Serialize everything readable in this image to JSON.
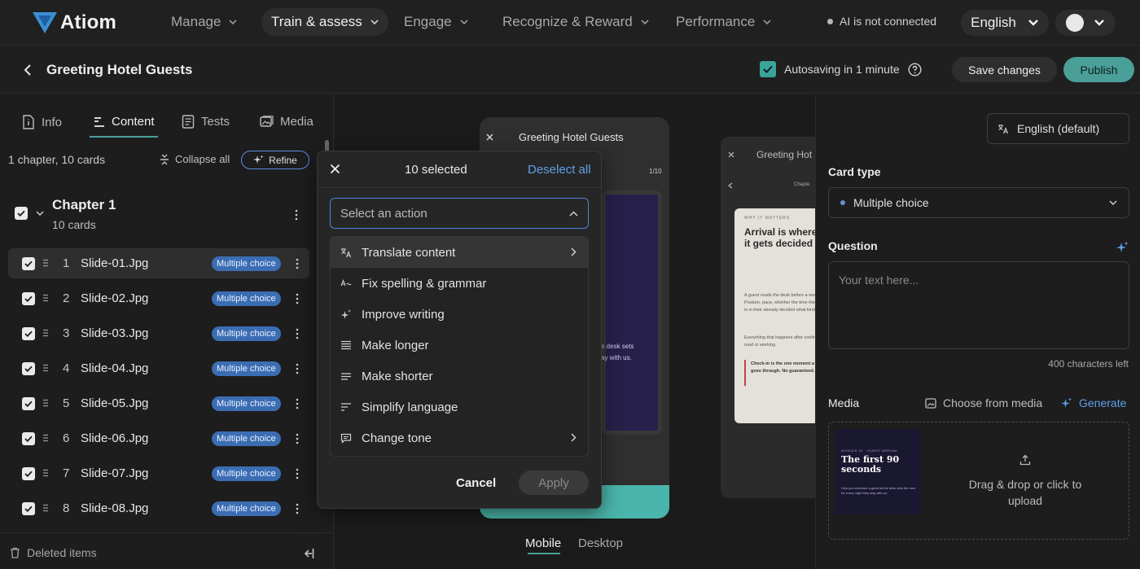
{
  "app": {
    "logo_text": "Atiom"
  },
  "nav": {
    "items": [
      {
        "label": "Manage"
      },
      {
        "label": "Train & assess"
      },
      {
        "label": "Engage"
      },
      {
        "label": "Recognize & Reward"
      },
      {
        "label": "Performance"
      }
    ],
    "ai_status": "AI is not connected",
    "language": "English"
  },
  "header": {
    "title": "Greeting Hotel Guests",
    "autosave": "Autosaving in 1 minute",
    "save_label": "Save changes",
    "publish_label": "Publish"
  },
  "left": {
    "tabs": [
      {
        "label": "Info"
      },
      {
        "label": "Content"
      },
      {
        "label": "Tests"
      },
      {
        "label": "Media"
      }
    ],
    "summary": "1 chapter, 10 cards",
    "collapse_label": "Collapse all",
    "refine_label": "Refine",
    "chapter": {
      "title": "Chapter 1",
      "subtitle": "10 cards"
    },
    "rows": [
      {
        "num": "1",
        "name": "Slide-01.Jpg",
        "badge": "Multiple choice"
      },
      {
        "num": "2",
        "name": "Slide-02.Jpg",
        "badge": "Multiple choice"
      },
      {
        "num": "3",
        "name": "Slide-03.Jpg",
        "badge": "Multiple choice"
      },
      {
        "num": "4",
        "name": "Slide-04.Jpg",
        "badge": "Multiple choice"
      },
      {
        "num": "5",
        "name": "Slide-05.Jpg",
        "badge": "Multiple choice"
      },
      {
        "num": "6",
        "name": "Slide-06.Jpg",
        "badge": "Multiple choice"
      },
      {
        "num": "7",
        "name": "Slide-07.Jpg",
        "badge": "Multiple choice"
      },
      {
        "num": "8",
        "name": "Slide-08.Jpg",
        "badge": "Multiple choice"
      }
    ],
    "deleted_label": "Deleted items"
  },
  "preview": {
    "phone1_title": "Greeting Hotel Guests",
    "phone1_counter": "1/10",
    "phone1_snippet_1": "e desk sets",
    "phone1_snippet_2": "ay with us.",
    "phone2_title": "Greeting Hot",
    "phone2_chapter": "Chapte",
    "phone2_kicker": "WHY IT MATTERS",
    "phone2_heading": "Arrival is where it gets decided",
    "phone2_body_1": "A guest reads the desk before a word. Posture, pace, whether the time the key card is in their already decided what kind",
    "phone2_body_2": "Everything that happens after confirms that read or working",
    "phone2_quote": "Check-in is the one moment a guest goes through. No guaranteed.",
    "modes": [
      {
        "label": "Mobile"
      },
      {
        "label": "Desktop"
      }
    ]
  },
  "modal": {
    "title": "10 selected",
    "deselect_label": "Deselect all",
    "select_placeholder": "Select an action",
    "actions": [
      {
        "label": "Translate content"
      },
      {
        "label": "Fix spelling & grammar"
      },
      {
        "label": "Improve writing"
      },
      {
        "label": "Make longer"
      },
      {
        "label": "Make shorter"
      },
      {
        "label": "Simplify language"
      },
      {
        "label": "Change tone"
      }
    ],
    "cancel_label": "Cancel",
    "apply_label": "Apply"
  },
  "right": {
    "language_label": "English (default)",
    "card_type_label": "Card type",
    "card_type_value": "Multiple choice",
    "question_label": "Question",
    "question_placeholder": "Your text here...",
    "chars_left": "400 characters left",
    "media_label": "Media",
    "choose_media_label": "Choose from media",
    "generate_label": "Generate",
    "thumb_kicker": "MODULE 01 · GUEST ARRIVAL",
    "thumb_title": "The first 90 seconds",
    "thumb_body": "How you welcome a guest at the desk sets the tone for every night they stay with us.",
    "dropzone_text": "Drag & drop or click to upload"
  },
  "colors": {
    "accent": "#4a9f99",
    "badge": "#3b6db3",
    "link": "#5ea0e8"
  }
}
